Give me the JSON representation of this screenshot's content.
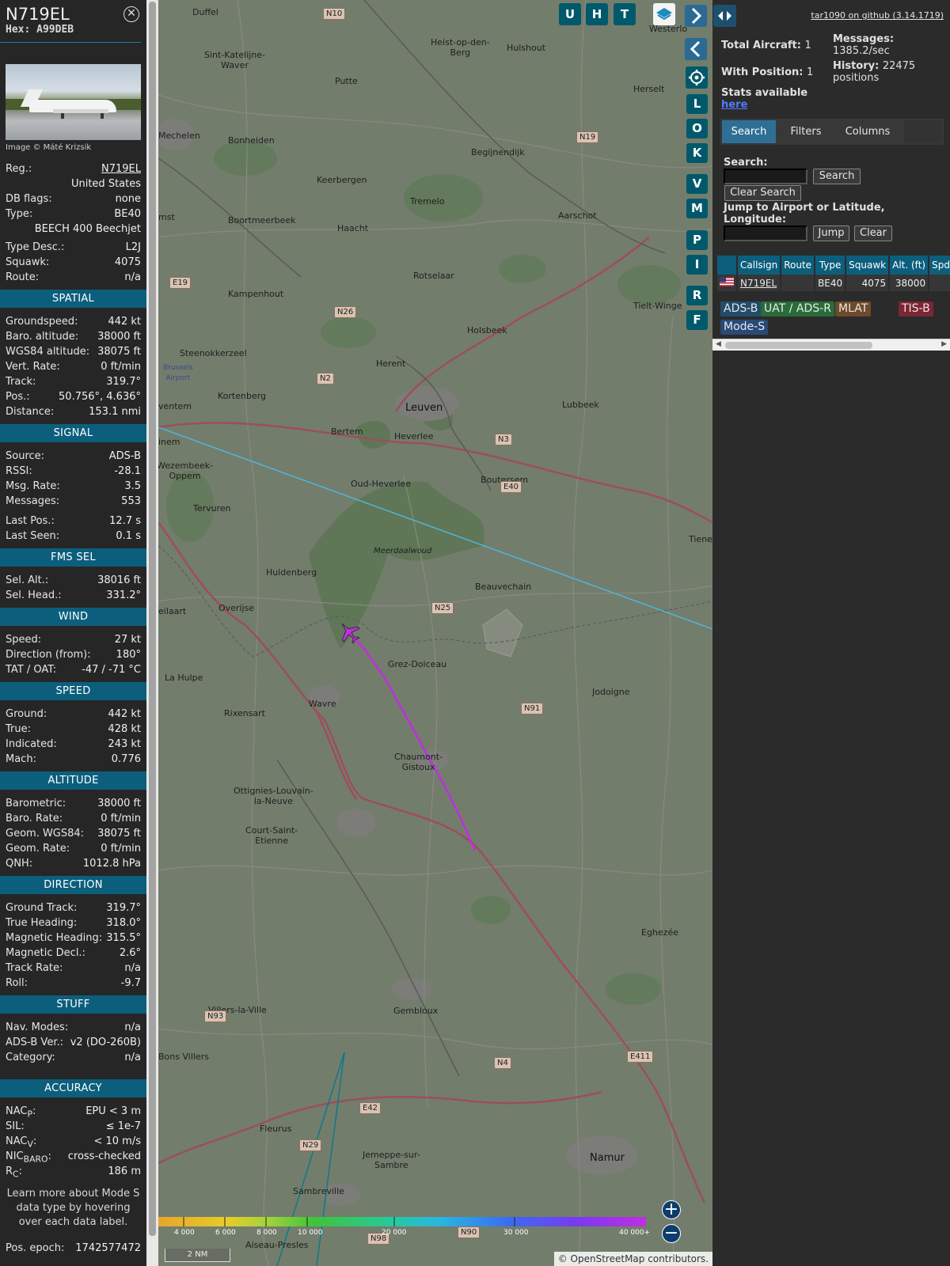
{
  "aircraft": {
    "callsign": "N719EL",
    "hex": "Hex: A99DEB",
    "image_credit": "Image © Máté Krizsik",
    "info": [
      {
        "label": "Reg.:",
        "value": "N719EL",
        "link": true
      },
      {
        "label": "",
        "value": "United States"
      },
      {
        "label": "DB flags:",
        "value": "none"
      },
      {
        "label": "Type:",
        "value": "BE40"
      },
      {
        "label": "",
        "value": "BEECH 400 Beechjet"
      },
      {
        "label": "Type Desc.:",
        "value": "L2J"
      },
      {
        "label": "Squawk:",
        "value": "4075"
      },
      {
        "label": "Route:",
        "value": "n/a"
      }
    ],
    "sections": [
      {
        "title": "SPATIAL",
        "rows": [
          {
            "label": "Groundspeed:",
            "value": "442 kt"
          },
          {
            "label": "Baro. altitude:",
            "value": "38000 ft"
          },
          {
            "label": "WGS84 altitude:",
            "value": "38075 ft"
          },
          {
            "label": "Vert. Rate:",
            "value": "0 ft/min"
          },
          {
            "label": "Track:",
            "value": "319.7°"
          },
          {
            "label": "Pos.:",
            "value": "50.756°, 4.636°"
          },
          {
            "label": "Distance:",
            "value": "153.1 nmi"
          }
        ]
      },
      {
        "title": "SIGNAL",
        "rows": [
          {
            "label": "Source:",
            "value": "ADS-B"
          },
          {
            "label": "RSSI:",
            "value": "-28.1"
          },
          {
            "label": "Msg. Rate:",
            "value": "3.5"
          },
          {
            "label": "Messages:",
            "value": "553"
          },
          {
            "gap": true
          },
          {
            "label": "Last Pos.:",
            "value": "12.7 s"
          },
          {
            "label": "Last Seen:",
            "value": "0.1 s"
          }
        ]
      },
      {
        "title": "FMS SEL",
        "rows": [
          {
            "label": "Sel. Alt.:",
            "value": "38016 ft"
          },
          {
            "label": "Sel. Head.:",
            "value": "331.2°"
          }
        ]
      },
      {
        "title": "WIND",
        "rows": [
          {
            "label": "Speed:",
            "value": "27 kt"
          },
          {
            "label": "Direction (from):",
            "value": "180°"
          },
          {
            "label": "TAT / OAT:",
            "value": "-47 / -71 °C"
          }
        ]
      },
      {
        "title": "SPEED",
        "rows": [
          {
            "label": "Ground:",
            "value": "442 kt"
          },
          {
            "label": "True:",
            "value": "428 kt"
          },
          {
            "label": "Indicated:",
            "value": "243 kt"
          },
          {
            "label": "Mach:",
            "value": "0.776"
          }
        ]
      },
      {
        "title": "ALTITUDE",
        "rows": [
          {
            "label": "Barometric:",
            "value": "38000 ft"
          },
          {
            "label": "Baro. Rate:",
            "value": "0 ft/min"
          },
          {
            "label": "Geom. WGS84:",
            "value": "38075 ft"
          },
          {
            "label": "Geom. Rate:",
            "value": "0 ft/min"
          },
          {
            "label": "QNH:",
            "value": "1012.8 hPa"
          }
        ]
      },
      {
        "title": "DIRECTION",
        "rows": [
          {
            "label": "Ground Track:",
            "value": "319.7°"
          },
          {
            "label": "True Heading:",
            "value": "318.0°"
          },
          {
            "label": "Magnetic Heading:",
            "value": "315.5°"
          },
          {
            "label": "Magnetic Decl.:",
            "value": "2.6°"
          },
          {
            "label": "Track Rate:",
            "value": "n/a"
          },
          {
            "label": "Roll:",
            "value": "-9.7"
          }
        ]
      },
      {
        "title": "STUFF",
        "rows": [
          {
            "label": "Nav. Modes:",
            "value": "n/a"
          },
          {
            "label": "ADS-B Ver.:",
            "value": "v2 (DO-260B)"
          },
          {
            "label": "Category:",
            "value": "n/a"
          },
          {
            "gap": true
          },
          {
            "gap": true
          }
        ]
      },
      {
        "title": "ACCURACY",
        "rows": [
          {
            "label": "NAC<sub>P</sub>:",
            "value": "EPU < 3 m",
            "html": true
          },
          {
            "label": "SIL:",
            "value": "≤ 1e-7"
          },
          {
            "label": "NAC<sub>V</sub>:",
            "value": "< 10 m/s",
            "html": true
          },
          {
            "label": "NIC<sub>BARO</sub>:",
            "value": "cross-checked",
            "html": true
          },
          {
            "label": "R<sub>C</sub>:",
            "value": "186 m",
            "html": true
          }
        ]
      }
    ],
    "note": "Learn more about Mode S data type by hovering over each data label.",
    "epoch_label": "Pos. epoch:",
    "epoch_value": "1742577472"
  },
  "map": {
    "buttons_top": [
      "U",
      "H",
      "T"
    ],
    "buttons_side": [
      "L",
      "O",
      "K",
      "V",
      "M",
      "P",
      "I",
      "R",
      "F"
    ],
    "scale": "2 NM",
    "attribution": "© OpenStreetMap contributors.",
    "altitude_labels": [
      "4 000",
      "6 000",
      "8 000",
      "10 000",
      "20 000",
      "30 000",
      "40 000+"
    ],
    "places": [
      {
        "t": "Duffel"
      },
      {
        "t": "Heist-op-den-\nBerg"
      },
      {
        "t": "Hulshout"
      },
      {
        "t": "Sint-Katelijne-\nWaver"
      },
      {
        "t": "Putte"
      },
      {
        "t": "Westerlo"
      },
      {
        "t": "Herselt"
      },
      {
        "t": "Mechelen"
      },
      {
        "t": "Bonheiden"
      },
      {
        "t": "Begijnendijk"
      },
      {
        "t": "Keerbergen"
      },
      {
        "t": "Tremelo"
      },
      {
        "t": "Aarschot"
      },
      {
        "t": "Boortmeerbeek"
      },
      {
        "t": "Haacht"
      },
      {
        "t": "Rotselaar"
      },
      {
        "t": "Kampenhout"
      },
      {
        "t": "Holsbeek"
      },
      {
        "t": "Tielt-Winge"
      },
      {
        "t": "Steenokkerzeel"
      },
      {
        "t": "Herent"
      },
      {
        "t": "Kortenberg"
      },
      {
        "t": "Leuven",
        "big": true
      },
      {
        "t": "Lubbeek"
      },
      {
        "t": "Bertem"
      },
      {
        "t": "Heverlee"
      },
      {
        "t": "Wezembeek-\nOppem"
      },
      {
        "t": "Oud-Heverlee"
      },
      {
        "t": "Boutersem"
      },
      {
        "t": "Tervuren"
      },
      {
        "t": "Meerdaalwoud"
      },
      {
        "t": "Tiene"
      },
      {
        "t": "Huldenberg"
      },
      {
        "t": "Beauvechain"
      },
      {
        "t": "Overijse"
      },
      {
        "t": "Grez-Doiceau"
      },
      {
        "t": "La Hulpe"
      },
      {
        "t": "Wavre"
      },
      {
        "t": "Jodoigne"
      },
      {
        "t": "Rixensart"
      },
      {
        "t": "Chaumont-\nGistoux"
      },
      {
        "t": "Ottignies-Louvain-\nla-Neuve"
      },
      {
        "t": "Court-Saint-\nEtienne"
      },
      {
        "t": "Eghezée"
      },
      {
        "t": "Villers-la-Ville"
      },
      {
        "t": "Gembloux"
      },
      {
        "t": "Bons Villers"
      },
      {
        "t": "Fleurus"
      },
      {
        "t": "Jemeppe-sur-\nSambre"
      },
      {
        "t": "Namur",
        "big": true
      },
      {
        "t": "Sambreville"
      },
      {
        "t": "Aiseau-Presles"
      },
      {
        "t": "Brussels\nAirport"
      },
      {
        "t": "inem"
      },
      {
        "t": "ventem"
      },
      {
        "t": "eilaart"
      },
      {
        "t": "mst"
      }
    ],
    "shields": [
      "N10",
      "N19",
      "N26",
      "N2",
      "N3",
      "E40",
      "N25",
      "N91",
      "E19",
      "N93",
      "N29",
      "N4",
      "E411",
      "E42",
      "N98",
      "N90"
    ]
  },
  "right": {
    "github": "tar1090 on github (3.14.1719)",
    "total_aircraft_label": "Total Aircraft:",
    "total_aircraft": "1",
    "with_position_label": "With Position:",
    "with_position": "1",
    "messages_label": "Messages:",
    "messages": "1385.2/sec",
    "history_label": "History:",
    "history": "22475 positions",
    "stats_label": "Stats available",
    "stats_link": "here",
    "tabs": [
      "Search",
      "Filters",
      "Columns"
    ],
    "search_label": "Search:",
    "search_button": "Search",
    "clear_search": "Clear Search",
    "jump_label": "Jump to Airport or Latitude, Longitude:",
    "jump_button": "Jump",
    "clear_button": "Clear",
    "table": {
      "columns": [
        "",
        "Callsign",
        "Route",
        "Type",
        "Squawk",
        "Alt. (ft)",
        "Spd."
      ],
      "rows": [
        [
          "flag-us",
          "N719EL",
          "",
          "BE40",
          "4075",
          "38000",
          ""
        ]
      ]
    },
    "legend": [
      {
        "t": "ADS-B",
        "bg": "#234c68",
        "c": "#dfe8ee"
      },
      {
        "t": "UAT / ADS-R",
        "bg": "#2a6b3a",
        "c": "#e3efe5"
      },
      {
        "t": "MLAT",
        "bg": "#6b4b2d",
        "c": "#f2e6da"
      },
      {
        "t": "TIS-B",
        "bg": "#7a2634",
        "c": "#f5dfe2"
      },
      {
        "t": "Mode-S",
        "bg": "#2a4a76",
        "c": "#e1e8f3"
      }
    ]
  },
  "colors": {
    "accent": "#0c5f7c",
    "track": "#c02ee0",
    "button": "#00596b"
  }
}
